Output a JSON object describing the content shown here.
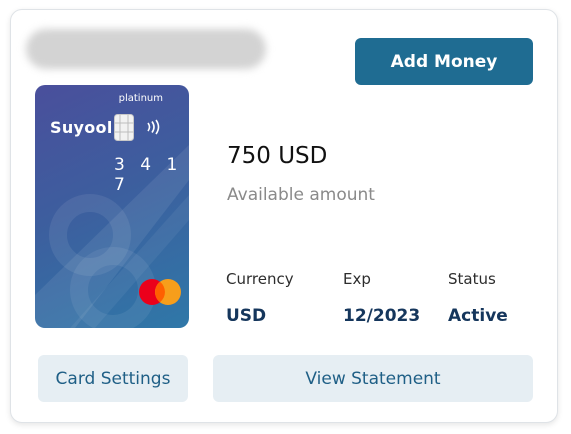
{
  "card_panel": {
    "add_money_label": "Add Money",
    "card": {
      "tier": "platinum",
      "brand": "Suyool",
      "last4": "3 4 1 7",
      "network_icon": "mastercard-icon"
    },
    "balance": {
      "amount": "750 USD",
      "label": "Available amount"
    },
    "details": [
      {
        "label": "Currency",
        "value": "USD"
      },
      {
        "label": "Exp",
        "value": "12/2023"
      },
      {
        "label": "Status",
        "value": "Active"
      }
    ],
    "card_settings_label": "Card Settings",
    "view_statement_label": "View Statement"
  },
  "colors": {
    "primary_button": "#1f6c92",
    "secondary_button_bg": "#e6eef3",
    "detail_value": "#15365c",
    "card_gradient_start": "#4a4f9c",
    "card_gradient_end": "#2f78a8",
    "mastercard_red": "#eb001b",
    "mastercard_orange": "#f79e1b"
  }
}
